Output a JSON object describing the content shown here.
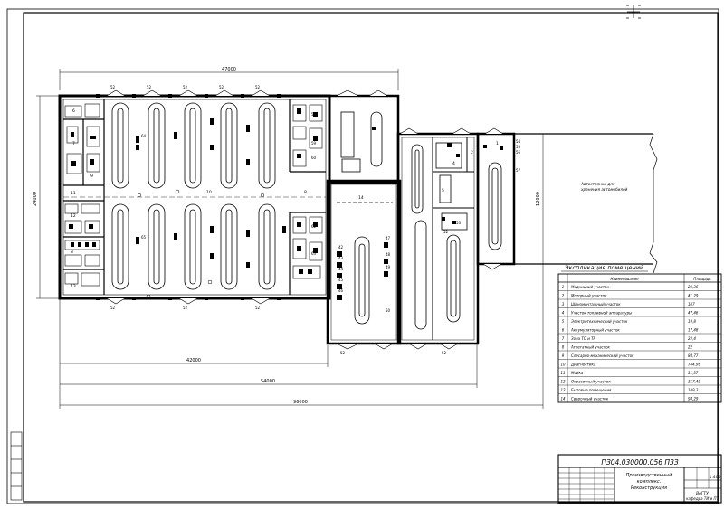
{
  "drawing": {
    "code": "ПЗ04.030000.056 ПЗЗ",
    "title_lines": [
      "Производственный",
      "комплекс.",
      "Реконструкция"
    ],
    "scale": "1:400",
    "org_lines": [
      "ВоГТУ",
      "кафедра ТИ и ПТ"
    ]
  },
  "dimensions": {
    "top_width": "47000",
    "left_height": "24000",
    "right_height": "12000",
    "bottom_mid": "42000",
    "bottom_long": "54000",
    "bottom_total": "96000"
  },
  "annotation": [
    "Автостоянка для",
    "хранения автомобилей"
  ],
  "explication": {
    "title": "Экспликация помещений",
    "col_name": "Наименование",
    "col_area": "Площадь",
    "rows": [
      {
        "n": "1",
        "name": "Медницкий участок",
        "area": "20,36"
      },
      {
        "n": "2",
        "name": "Моторный участок",
        "area": "41,29"
      },
      {
        "n": "3",
        "name": "Шиномонтажный участок",
        "area": "107"
      },
      {
        "n": "4",
        "name": "Участок топливной аппаратуры",
        "area": "47,46"
      },
      {
        "n": "5",
        "name": "Электротехнический участок",
        "area": "19,8"
      },
      {
        "n": "6",
        "name": "Аккумуляторный участок",
        "area": "17,48"
      },
      {
        "n": "7",
        "name": "Зона ТО и ТР",
        "area": "22,4"
      },
      {
        "n": "8",
        "name": "Агрегатный участок",
        "area": "22"
      },
      {
        "n": "9",
        "name": "Слесарно-механический участок",
        "area": "84,77"
      },
      {
        "n": "10",
        "name": "Диагностика",
        "area": "744,96"
      },
      {
        "n": "11",
        "name": "Мойка",
        "area": "31,37"
      },
      {
        "n": "12",
        "name": "Окрасочный участок",
        "area": "317,49"
      },
      {
        "n": "13",
        "name": "Бытовые помещения",
        "area": "109,3"
      },
      {
        "n": "14",
        "name": "Сварочный участок",
        "area": "94,29"
      }
    ]
  },
  "room_labels": [
    "6",
    "7",
    "9",
    "11",
    "12",
    "3",
    "13",
    "14",
    "10",
    "8",
    "5",
    "4",
    "2",
    "1"
  ],
  "equipment_labels": [
    "42",
    "43",
    "44",
    "45",
    "46",
    "47",
    "48",
    "49",
    "50",
    "52",
    "53",
    "54",
    "55",
    "56",
    "57",
    "58",
    "59",
    "60",
    "62",
    "63",
    "64",
    "65"
  ],
  "doors": [
    "52",
    "52",
    "52",
    "52",
    "52",
    "52",
    "52",
    "52",
    "52",
    "52"
  ]
}
